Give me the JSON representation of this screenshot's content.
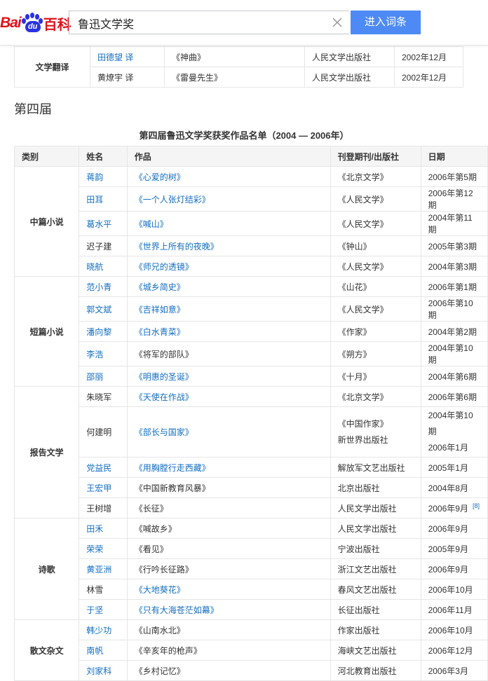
{
  "header": {
    "logo": {
      "bai": "Bai",
      "du": "du",
      "baike": "百科"
    },
    "search": {
      "value": "鲁迅文学奖",
      "button_label": "进入词条"
    }
  },
  "top_table": {
    "category": "文学翻译",
    "rows": [
      {
        "name": "田德望 译",
        "name_link": true,
        "work": "《神曲》",
        "work_link": false,
        "publisher": "人民文学出版社",
        "date": "2002年12月"
      },
      {
        "name": "黄燎宇 译",
        "name_link": false,
        "work": "《雷曼先生》",
        "work_link": false,
        "publisher": "人民文学出版社",
        "date": "2002年12月"
      }
    ]
  },
  "section_title": "第四届",
  "table_caption": "第四届鲁迅文学奖获奖作品名单（2004 — 2006年）",
  "headers": {
    "category": "类别",
    "name": "姓名",
    "work": "作品",
    "publisher": "刊登期刊/出版社",
    "date": "日期"
  },
  "groups": [
    {
      "category": "中篇小说",
      "rows": [
        {
          "name": "蒋韵",
          "name_link": true,
          "work": "《心爱的树》",
          "work_link": true,
          "publisher": "《北京文学》",
          "date": "2006年第5期"
        },
        {
          "name": "田耳",
          "name_link": true,
          "work": "《一个人张灯结彩》",
          "work_link": true,
          "publisher": "《人民文学》",
          "date": "2006年第12期"
        },
        {
          "name": "葛水平",
          "name_link": true,
          "work": "《喊山》",
          "work_link": true,
          "publisher": "《人民文学》",
          "date": "2004年第11期"
        },
        {
          "name": "迟子建",
          "name_link": false,
          "work": "《世界上所有的夜晚》",
          "work_link": true,
          "publisher": "《钟山》",
          "date": "2005年第3期"
        },
        {
          "name": "晓航",
          "name_link": true,
          "work": "《师兄的透镜》",
          "work_link": true,
          "publisher": "《人民文学》",
          "date": "2004年第3期"
        }
      ]
    },
    {
      "category": "短篇小说",
      "rows": [
        {
          "name": "范小青",
          "name_link": true,
          "work": "《城乡简史》",
          "work_link": true,
          "publisher": "《山花》",
          "date": "2006年第1期"
        },
        {
          "name": "郭文斌",
          "name_link": true,
          "work": "《吉祥如意》",
          "work_link": true,
          "publisher": "《人民文学》",
          "date": "2006年第10期"
        },
        {
          "name": "潘向黎",
          "name_link": true,
          "work": "《白水青菜》",
          "work_link": true,
          "publisher": "《作家》",
          "date": "2004年第2期"
        },
        {
          "name": "李浩",
          "name_link": true,
          "work": "《将军的部队》",
          "work_link": false,
          "publisher": "《朔方》",
          "date": "2004年第10期"
        },
        {
          "name": "邵丽",
          "name_link": true,
          "work": "《明惠的圣诞》",
          "work_link": true,
          "publisher": "《十月》",
          "date": "2004年第6期"
        }
      ]
    },
    {
      "category": "报告文学",
      "rows": [
        {
          "name": "朱晓军",
          "name_link": false,
          "work": "《天使在作战》",
          "work_link": true,
          "publisher": "《北京文学》",
          "date": "2006年第6期"
        },
        {
          "name": "何建明",
          "name_link": false,
          "work": "《部长与国家》",
          "work_link": true,
          "publisher": "《中国作家》",
          "publisher2": "新世界出版社",
          "date": "2004年第10期",
          "date2": "2006年1月"
        },
        {
          "name": "党益民",
          "name_link": true,
          "work": "《用胸膛行走西藏》",
          "work_link": true,
          "publisher": "解放军文艺出版社",
          "date": "2005年1月"
        },
        {
          "name": "王宏甲",
          "name_link": true,
          "work": "《中国新教育风暴》",
          "work_link": false,
          "publisher": "北京出版社",
          "date": "2004年8月"
        },
        {
          "name": "王树增",
          "name_link": false,
          "work": "《长征》",
          "work_link": false,
          "publisher": "人民文学出版社",
          "date": "2006年9月",
          "ref": "[8]"
        }
      ]
    },
    {
      "category": "诗歌",
      "rows": [
        {
          "name": "田禾",
          "name_link": true,
          "work": "《喊故乡》",
          "work_link": false,
          "publisher": "人民文学出版社",
          "date": "2006年9月"
        },
        {
          "name": "荣荣",
          "name_link": true,
          "work": "《看见》",
          "work_link": false,
          "publisher": "宁波出版社",
          "date": "2005年9月"
        },
        {
          "name": "黄亚洲",
          "name_link": true,
          "work": "《行吟长征路》",
          "work_link": false,
          "publisher": "浙江文艺出版社",
          "date": "2006年9月"
        },
        {
          "name": "林雪",
          "name_link": false,
          "work": "《大地葵花》",
          "work_link": true,
          "publisher": "春风文艺出版社",
          "date": "2006年10月"
        },
        {
          "name": "于坚",
          "name_link": true,
          "work": "《只有大海苍茫如幕》",
          "work_link": true,
          "publisher": "长征出版社",
          "date": "2006年11月"
        }
      ]
    },
    {
      "category": "散文杂文",
      "rows": [
        {
          "name": "韩少功",
          "name_link": true,
          "work": "《山南水北》",
          "work_link": false,
          "publisher": "作家出版社",
          "date": "2006年10月"
        },
        {
          "name": "南帆",
          "name_link": true,
          "work": "《辛亥年的枪声》",
          "work_link": false,
          "publisher": "海峡文艺出版社",
          "date": "2006年12月"
        },
        {
          "name": "刘家科",
          "name_link": true,
          "work": "《乡村记忆》",
          "work_link": false,
          "publisher": "河北教育出版社",
          "date": "2006年3月"
        }
      ]
    }
  ],
  "colors": {
    "link": "#136ec2",
    "search_button": "#4e8af5",
    "logo_red": "#e0121b",
    "logo_blue": "#2932e1"
  }
}
